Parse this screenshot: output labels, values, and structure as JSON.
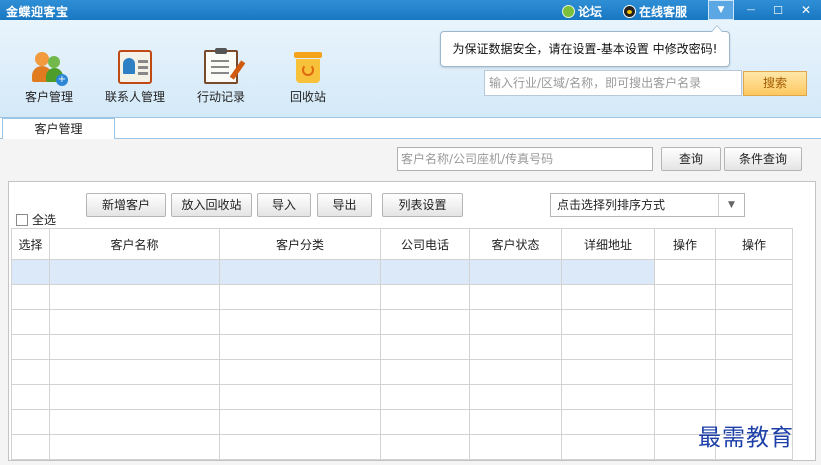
{
  "titlebar": {
    "app_title": "金蝶迎客宝",
    "forum_label": "论坛",
    "support_label": "在线客服",
    "dropdown_glyph": "▼",
    "minimize_glyph": "—",
    "maximize_glyph": "☐",
    "close_glyph": "✕"
  },
  "toolbar": {
    "items": [
      {
        "label": "客户管理",
        "icon": "customers-icon"
      },
      {
        "label": "联系人管理",
        "icon": "contact-card-icon"
      },
      {
        "label": "行动记录",
        "icon": "clipboard-icon"
      },
      {
        "label": "回收站",
        "icon": "recycle-bin-icon"
      }
    ]
  },
  "tooltip": {
    "text": "为保证数据安全，请在设置-基本设置 中修改密码!"
  },
  "top_search": {
    "placeholder": "输入行业/区域/名称，即可搜出客户名录",
    "button": "搜索"
  },
  "tabs": [
    {
      "label": "客户管理",
      "active": true
    }
  ],
  "filter": {
    "placeholder": "客户名称/公司座机/传真号码",
    "query_button": "查询",
    "condition_query_button": "条件查询"
  },
  "actions": {
    "select_all": "全选",
    "new_customer": "新增客户",
    "to_recycle": "放入回收站",
    "import": "导入",
    "export": "导出",
    "list_settings": "列表设置",
    "sort_select": "点击选择列排序方式"
  },
  "table": {
    "columns": [
      "选择",
      "客户名称",
      "客户分类",
      "公司电话",
      "客户状态",
      "详细地址",
      "操作",
      "操作"
    ],
    "row_count": 8,
    "selected_row": 0
  },
  "colors": {
    "titlebar": "#1877c2",
    "toolbar_bg": "#d4e9f8",
    "search_button": "#fcc860",
    "selected_row": "#dbe9f8",
    "watermark": "#1c3fa8"
  },
  "watermark": "最需教育"
}
